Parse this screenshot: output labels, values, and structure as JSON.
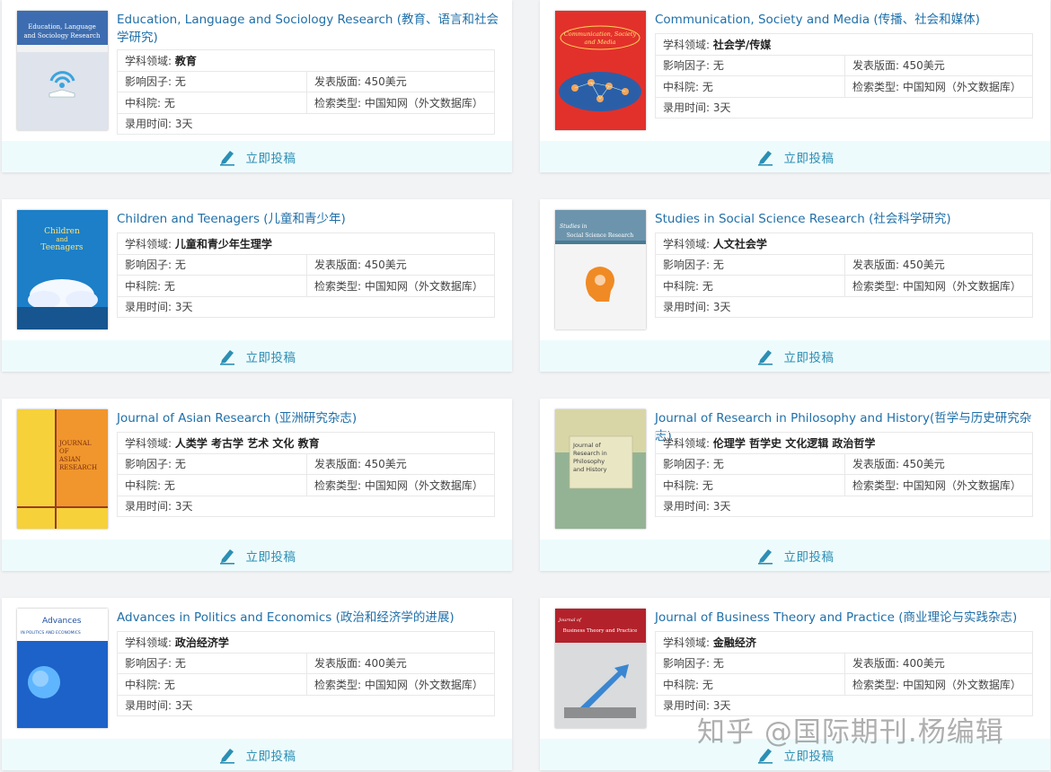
{
  "submit_label": "立即投稿",
  "labels": {
    "field": "学科领域:",
    "impact": "影响因子:",
    "fee": "发表版面:",
    "cas": "中科院:",
    "index": "检索类型:",
    "time": "录用时间:"
  },
  "journals": [
    {
      "title": "Education, Language and Sociology Research (教育、语言和社会学研究)",
      "field": "教育",
      "impact": "无",
      "fee": "450美元",
      "cas": "无",
      "index": "中国知网（外文数据库）",
      "time": "3天",
      "cover_text": [
        "Education, Language",
        "and Sociology Research"
      ]
    },
    {
      "title": "Communication, Society and Media (传播、社会和媒体)",
      "field": "社会学/传媒",
      "impact": "无",
      "fee": "450美元",
      "cas": "无",
      "index": "中国知网（外文数据库）",
      "time": "3天",
      "cover_text": [
        "Communication, Society",
        "and Media"
      ]
    },
    {
      "title": "Children and Teenagers (儿童和青少年)",
      "field": "儿童和青少年生理学",
      "impact": "无",
      "fee": "450美元",
      "cas": "无",
      "index": "中国知网（外文数据库）",
      "time": "3天",
      "cover_text": [
        "Children",
        "and",
        "Teenagers"
      ]
    },
    {
      "title": "Studies in Social Science Research (社会科学研究)",
      "field": "人文社会学",
      "impact": "无",
      "fee": "450美元",
      "cas": "无",
      "index": "中国知网（外文数据库）",
      "time": "3天",
      "cover_text": [
        "Studies in",
        "Social Science Research"
      ]
    },
    {
      "title": "Journal of Asian Research (亚洲研究杂志)",
      "field": "人类学 考古学 艺术 文化 教育",
      "impact": "无",
      "fee": "450美元",
      "cas": "无",
      "index": "中国知网（外文数据库）",
      "time": "3天",
      "cover_text": [
        "JOURNAL",
        "OF",
        "ASIAN",
        "RESEARCH"
      ]
    },
    {
      "title": "Journal of Research in Philosophy and History(哲学与历史研究杂志)",
      "field": "伦理学 哲学史 文化逻辑 政治哲学",
      "impact": "无",
      "fee": "450美元",
      "cas": "无",
      "index": "中国知网（外文数据库）",
      "time": "3天",
      "cover_text": [
        "Journal of",
        "Research in",
        "Philosophy",
        "and History"
      ]
    },
    {
      "title": "Advances in Politics and Economics (政治和经济学的进展)",
      "field": "政治经济学",
      "impact": "无",
      "fee": "400美元",
      "cas": "无",
      "index": "中国知网（外文数据库）",
      "time": "3天",
      "cover_text": [
        "Advances",
        "IN POLITICS AND ECONOMICS"
      ]
    },
    {
      "title": "Journal of Business Theory and Practice (商业理论与实践杂志)",
      "field": "金融经济",
      "impact": "无",
      "fee": "400美元",
      "cas": "无",
      "index": "中国知网（外文数据库）",
      "time": "3天",
      "cover_text": [
        "Journal of",
        "Business Theory and Practice"
      ]
    }
  ],
  "watermark": "知乎 @国际期刊.杨编辑"
}
